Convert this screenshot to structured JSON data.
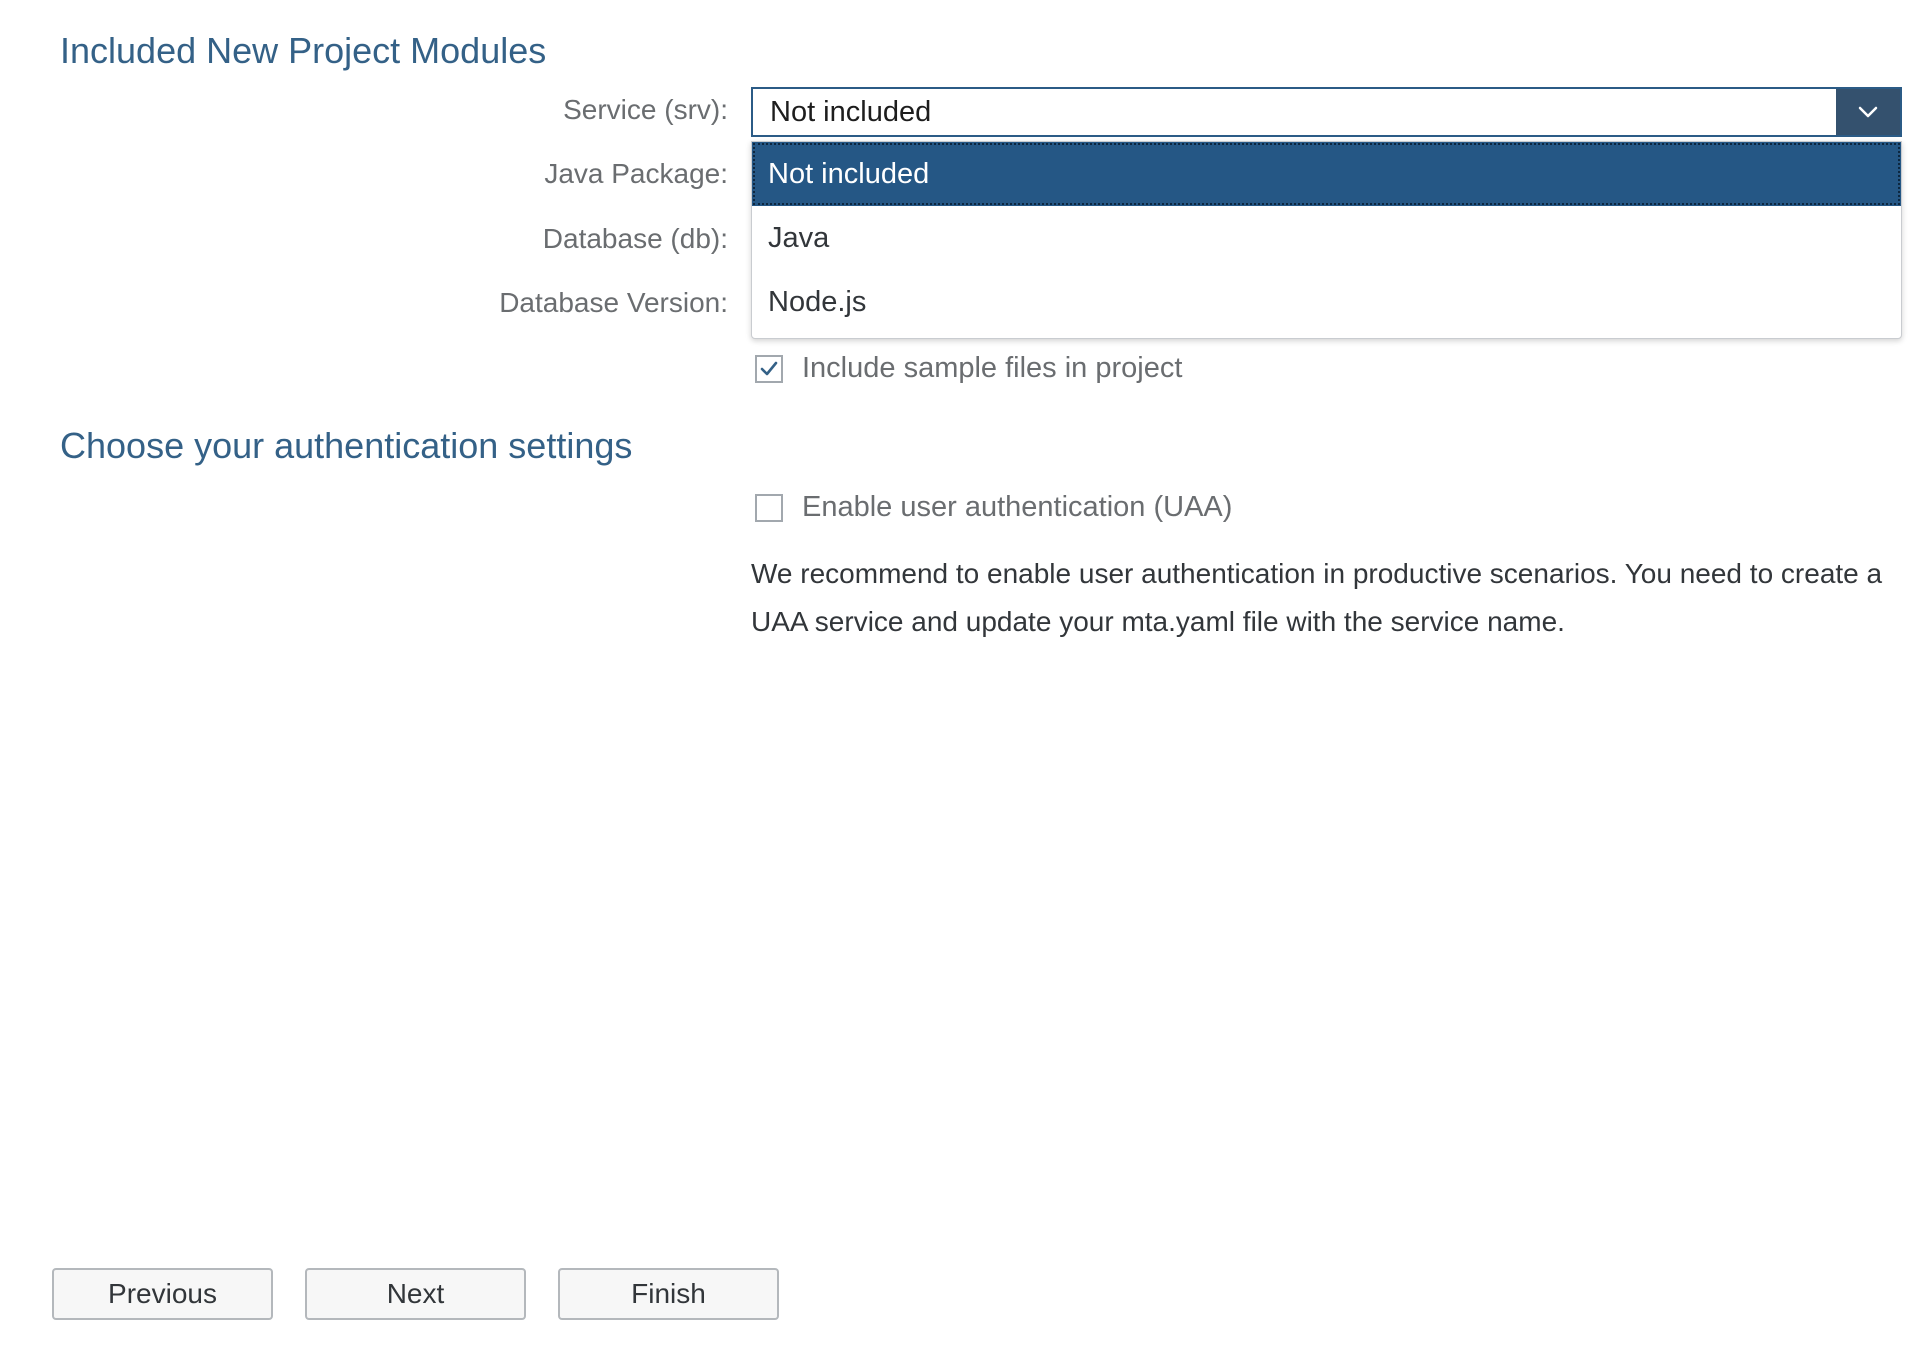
{
  "sections": {
    "modules_title": "Included New Project Modules",
    "auth_title": "Choose your authentication settings"
  },
  "fields": {
    "service_label": "Service (srv):",
    "java_package_label": "Java Package:",
    "database_label": "Database (db):",
    "database_version_label": "Database Version:"
  },
  "service_select": {
    "selected_value": "Not included",
    "options": [
      "Not included",
      "Java",
      "Node.js"
    ],
    "open": true
  },
  "checkboxes": {
    "sample_files": {
      "label": "Include sample files in project",
      "checked": true
    },
    "uaa": {
      "label": "Enable user authentication (UAA)",
      "checked": false
    }
  },
  "recommendation_text": "We recommend to enable user authentication in productive scenarios. You need to create a UAA service and update your mta.yaml file with the service name.",
  "buttons": {
    "previous": "Previous",
    "next": "Next",
    "finish": "Finish"
  },
  "colors": {
    "section_title": "#346187",
    "select_border": "#2b5b86",
    "select_arrow_bg": "#34516e",
    "option_selected_bg": "#255785",
    "checkbox_check": "#346187"
  },
  "icons": {
    "select_arrow": "chevron-down-icon",
    "checkmark": "checkmark-icon"
  }
}
